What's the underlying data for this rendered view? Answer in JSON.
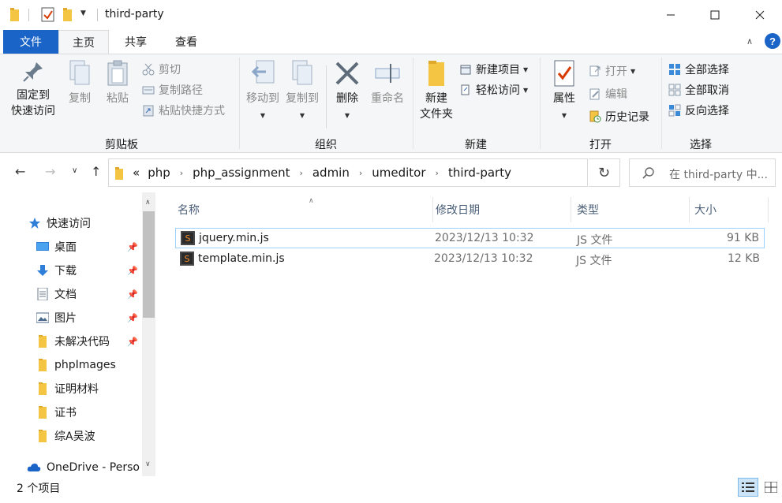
{
  "window": {
    "title": "third-party",
    "buttons": [
      "minimize-icon",
      "maximize-icon",
      "close-icon"
    ]
  },
  "ribbon_tabs": {
    "file": "文件",
    "home": "主页",
    "share": "共享",
    "view": "查看",
    "help": "?"
  },
  "ribbon": {
    "clipboard": {
      "label": "剪贴板",
      "pin_line1": "固定到",
      "pin_line2": "快速访问",
      "copy": "复制",
      "paste": "粘贴",
      "cut": "剪切",
      "copy_path": "复制路径",
      "paste_shortcut": "粘贴快捷方式"
    },
    "organize": {
      "label": "组织",
      "move_to": "移动到",
      "copy_to": "复制到",
      "delete": "删除",
      "rename": "重命名"
    },
    "new": {
      "label": "新建",
      "new_folder_line1": "新建",
      "new_folder_line2": "文件夹",
      "new_item": "新建项目",
      "easy_access": "轻松访问"
    },
    "open": {
      "label": "打开",
      "properties": "属性",
      "open": "打开",
      "edit": "编辑",
      "history": "历史记录"
    },
    "select": {
      "label": "选择",
      "select_all": "全部选择",
      "select_none": "全部取消",
      "invert": "反向选择"
    }
  },
  "address": {
    "overflow": "«",
    "crumbs": [
      "php",
      "php_assignment",
      "admin",
      "umeditor",
      "third-party"
    ],
    "search_placeholder": "在 third-party 中..."
  },
  "nav_pane": {
    "quick_access": "快速访问",
    "items": [
      {
        "label": "桌面",
        "pinned": true
      },
      {
        "label": "下载",
        "pinned": true
      },
      {
        "label": "文档",
        "pinned": true
      },
      {
        "label": "图片",
        "pinned": true
      },
      {
        "label": "未解决代码",
        "pinned": true
      },
      {
        "label": "phpImages",
        "pinned": false
      },
      {
        "label": "证明材料",
        "pinned": false
      },
      {
        "label": "证书",
        "pinned": false
      },
      {
        "label": "综A吴波",
        "pinned": false
      }
    ],
    "onedrive": "OneDrive - Perso"
  },
  "file_list": {
    "columns": [
      "名称",
      "修改日期",
      "类型",
      "大小"
    ],
    "rows": [
      {
        "name": "jquery.min.js",
        "date": "2023/12/13 10:32",
        "type": "JS 文件",
        "size": "91 KB",
        "selected": true
      },
      {
        "name": "template.min.js",
        "date": "2023/12/13 10:32",
        "type": "JS 文件",
        "size": "12 KB",
        "selected": false
      }
    ]
  },
  "status": {
    "item_count": "2 个项目"
  },
  "colors": {
    "accent": "#1a64c8",
    "folder": "#f4c542",
    "selection_border": "#99d1ff"
  }
}
